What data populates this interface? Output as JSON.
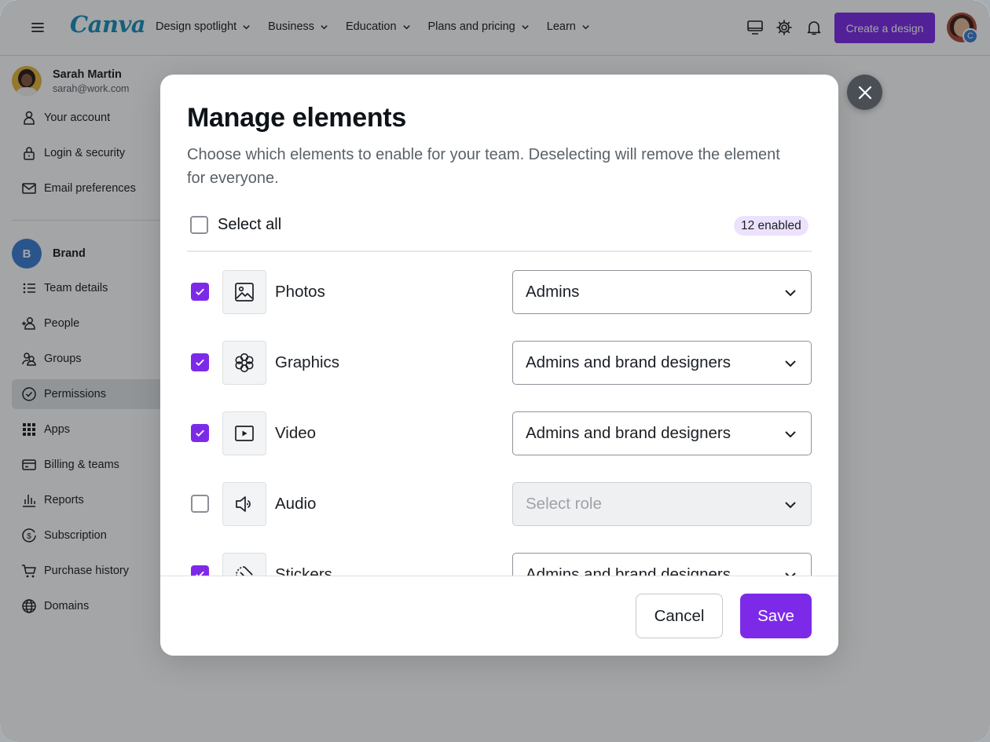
{
  "header": {
    "logo": "Canva",
    "nav": [
      {
        "label": "Design spotlight",
        "icon": "chevron-down-icon"
      },
      {
        "label": "Business",
        "icon": "chevron-down-icon"
      },
      {
        "label": "Education",
        "icon": "chevron-down-icon"
      },
      {
        "label": "Plans and pricing",
        "icon": "chevron-down-icon"
      },
      {
        "label": "Learn",
        "icon": "chevron-down-icon"
      }
    ],
    "icons": [
      "desktop-icon",
      "gear-icon",
      "bell-icon"
    ],
    "create_button": "Create a design",
    "avatar_badge": "C"
  },
  "sidebar": {
    "user": {
      "name": "Sarah Martin",
      "email": "sarah@work.com"
    },
    "account_items": [
      {
        "label": "Your account",
        "icon": "user-icon"
      },
      {
        "label": "Login & security",
        "icon": "lock-icon"
      },
      {
        "label": "Email preferences",
        "icon": "mail-icon"
      }
    ],
    "brand": {
      "initial": "B",
      "name": "Brand"
    },
    "team_items": [
      {
        "label": "Team details",
        "icon": "list-icon"
      },
      {
        "label": "People",
        "icon": "people-add-icon"
      },
      {
        "label": "Groups",
        "icon": "groups-icon"
      },
      {
        "label": "Permissions",
        "icon": "check-circle-icon",
        "active": true
      },
      {
        "label": "Apps",
        "icon": "grid-icon"
      },
      {
        "label": "Billing & teams",
        "icon": "card-icon"
      },
      {
        "label": "Reports",
        "icon": "bar-chart-icon"
      },
      {
        "label": "Subscription",
        "icon": "dollar-circle-icon"
      },
      {
        "label": "Purchase history",
        "icon": "cart-icon"
      },
      {
        "label": "Domains",
        "icon": "globe-icon"
      }
    ]
  },
  "modal": {
    "title": "Manage elements",
    "description": "Choose which elements to enable for your team. Deselecting will remove the element for everyone.",
    "select_all_label": "Select all",
    "enabled_count": "12 enabled",
    "elements": [
      {
        "label": "Photos",
        "checked": true,
        "role": "Admins",
        "icon": "image-icon"
      },
      {
        "label": "Graphics",
        "checked": true,
        "role": "Admins and brand designers",
        "icon": "flower-icon"
      },
      {
        "label": "Video",
        "checked": true,
        "role": "Admins and brand designers",
        "icon": "video-icon"
      },
      {
        "label": "Audio",
        "checked": false,
        "role": "Select role",
        "icon": "speaker-icon",
        "disabled": true
      },
      {
        "label": "Stickers",
        "checked": true,
        "role": "Admins and brand designers",
        "icon": "sticker-icon"
      }
    ],
    "cancel_label": "Cancel",
    "save_label": "Save"
  },
  "colors": {
    "accent": "#7d2ae8",
    "logo": "#1a8fbd",
    "badge": "#ece2fd"
  }
}
